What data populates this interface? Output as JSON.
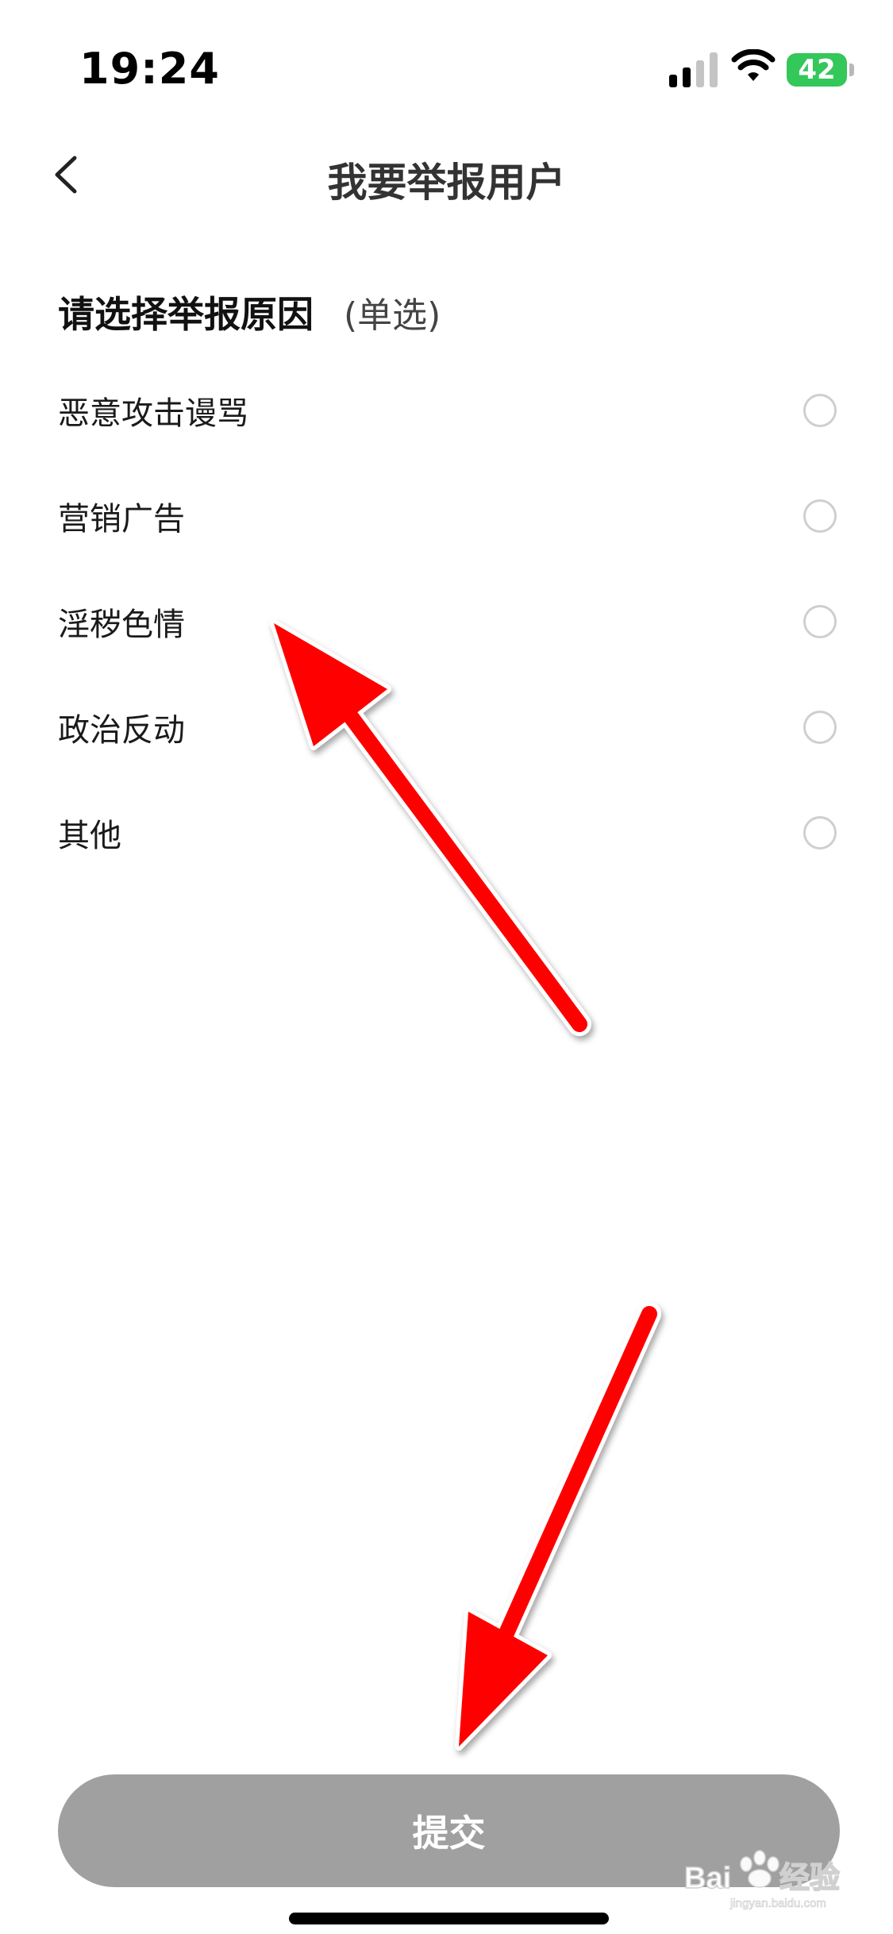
{
  "status_bar": {
    "time": "19:24",
    "battery": "42",
    "battery_color": "#34c759"
  },
  "nav": {
    "title": "我要举报用户",
    "back_icon": "chevron-left-icon"
  },
  "section": {
    "title": "请选择举报原因",
    "hint": "(单选)"
  },
  "options": [
    {
      "label": "恶意攻击谩骂",
      "selected": false
    },
    {
      "label": "营销广告",
      "selected": false
    },
    {
      "label": "淫秽色情",
      "selected": false
    },
    {
      "label": "政治反动",
      "selected": false
    },
    {
      "label": "其他",
      "selected": false
    }
  ],
  "submit": {
    "label": "提交",
    "enabled": false,
    "color": "#a0a0a0"
  },
  "annotation": {
    "arrow_color": "#ff0000"
  },
  "watermark": {
    "text": "Baidu经验",
    "subtext": "jingyan.baidu.com"
  }
}
